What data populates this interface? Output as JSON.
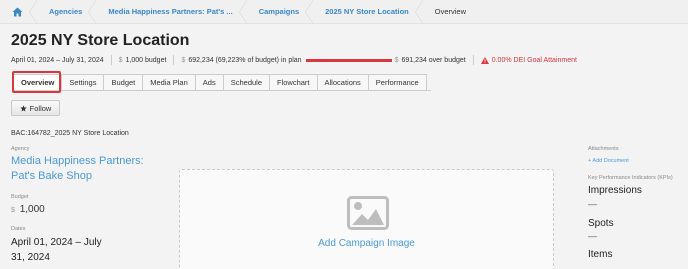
{
  "breadcrumb": {
    "items": [
      "Agencies",
      "Media Happiness Partners: Pat's ...",
      "Campaigns",
      "2025 NY Store Location"
    ],
    "current": "Overview"
  },
  "page_title": "2025 NY Store Location",
  "meta": {
    "dates": "April 01, 2024 – July 31, 2024",
    "currency": "$",
    "budget": "1,000 budget",
    "in_plan": "692,234 (69,223% of budget) in plan",
    "over_budget": "691,234 over budget",
    "dei": "0.00% DEI Goal Attainment"
  },
  "tabs": [
    "Overview",
    "Settings",
    "Budget",
    "Media Plan",
    "Ads",
    "Schedule",
    "Flowchart",
    "Allocations",
    "Performance"
  ],
  "follow_label": "Follow",
  "bac": "BAC:164782_2025 NY Store Location",
  "details": {
    "agency_label": "Agency",
    "agency_value": "Media Happiness Partners: Pat's Bake Shop",
    "budget_label": "Budget",
    "budget_currency": "$",
    "budget_value": "1,000",
    "dates_label": "Dates",
    "dates_value": "April 01, 2024 – July 31, 2024"
  },
  "image_box": {
    "label": "Add Campaign Image"
  },
  "sidebar": {
    "attachments_label": "Attachments",
    "add_document": "+ Add Document",
    "kpi_label": "Key Performance Indicators (KPIs)",
    "kpis": [
      {
        "name": "Impressions",
        "value": "—"
      },
      {
        "name": "Spots",
        "value": "—"
      },
      {
        "name": "Items",
        "value": ""
      }
    ]
  },
  "colors": {
    "accent": "#3a87c8",
    "warning": "#d9363e"
  }
}
